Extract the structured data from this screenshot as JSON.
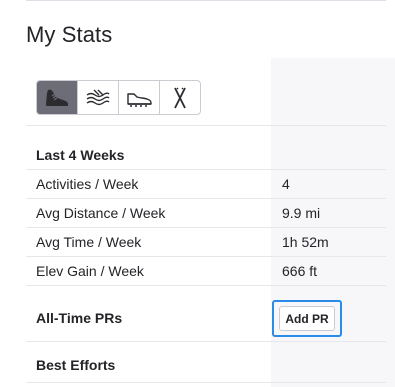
{
  "title": "My Stats",
  "sport_tabs": [
    {
      "icon": "run-shoe-icon",
      "active": true
    },
    {
      "icon": "swim-icon",
      "active": false
    },
    {
      "icon": "ride-shoe-icon",
      "active": false
    },
    {
      "icon": "ski-icon",
      "active": false
    }
  ],
  "recent": {
    "heading": "Last 4 Weeks",
    "rows": [
      {
        "label": "Activities / Week",
        "value": "4"
      },
      {
        "label": "Avg Distance / Week",
        "value": "9.9 mi"
      },
      {
        "label": "Avg Time / Week",
        "value": "1h 52m"
      },
      {
        "label": "Elev Gain / Week",
        "value": "666 ft"
      }
    ]
  },
  "prs": {
    "heading": "All-Time PRs",
    "button_label": "Add PR"
  },
  "best_efforts": {
    "heading": "Best Efforts"
  },
  "colors": {
    "active_tab": "#6d6d78",
    "focus_outline": "#2a8ce8",
    "shaded_column": "#f7f7fa"
  }
}
